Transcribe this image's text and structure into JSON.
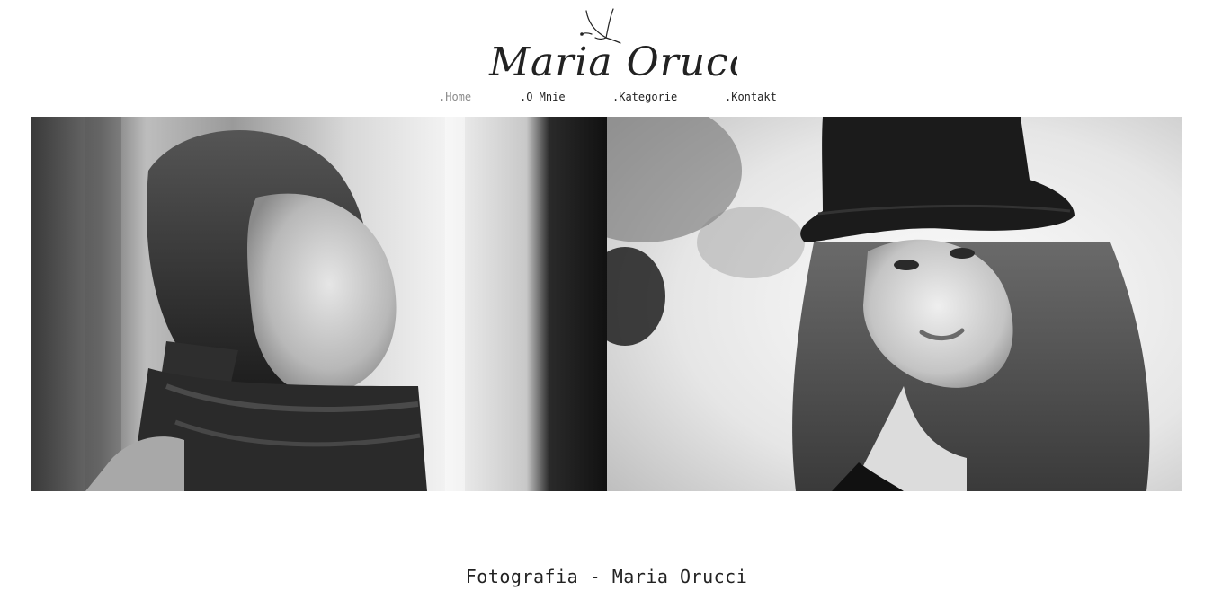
{
  "brand": {
    "name": "Maria Orucci",
    "logo_icon": "butterfly-icon"
  },
  "nav": {
    "items": [
      {
        "label": ".Home",
        "active": true
      },
      {
        "label": ".O Mnie",
        "active": false
      },
      {
        "label": ".Kategorie",
        "active": false
      },
      {
        "label": ".Kontakt",
        "active": false
      }
    ]
  },
  "gallery": {
    "photos": [
      {
        "subject": "portrait-profile-window"
      },
      {
        "subject": "portrait-hat"
      }
    ]
  },
  "footer": {
    "title": "Fotografia - Maria Orucci"
  },
  "colors": {
    "text": "#222222",
    "nav_active": "#8a8a8a",
    "background": "#ffffff"
  }
}
